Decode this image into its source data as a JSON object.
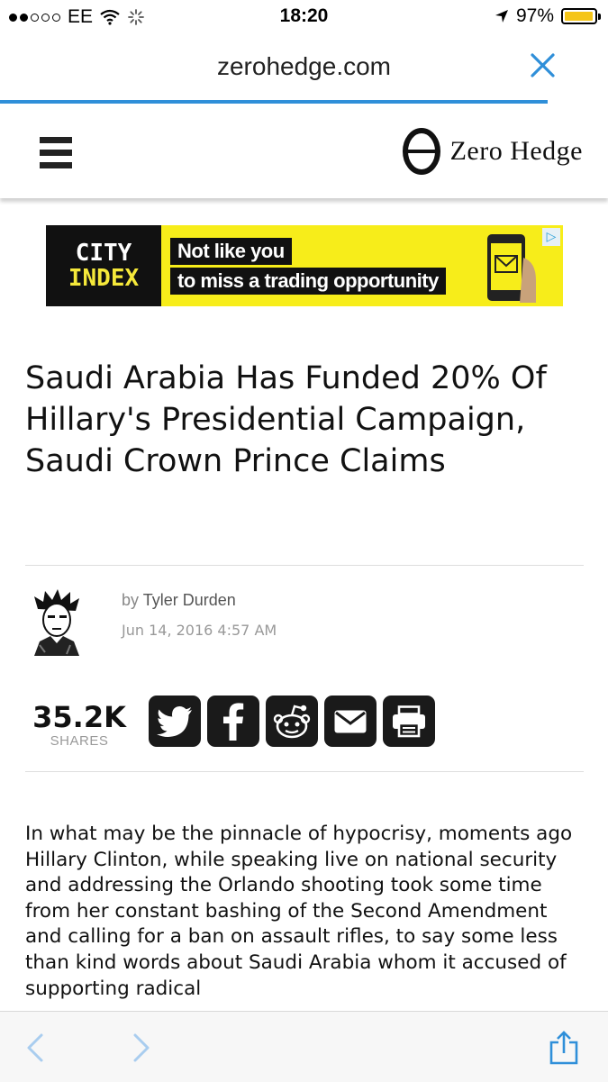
{
  "status_bar": {
    "carrier": "EE",
    "time": "18:20",
    "battery": "97%",
    "battery_level": 0.97
  },
  "browser": {
    "url": "zerohedge.com",
    "load_progress": 0.9
  },
  "site": {
    "logo_text": "Zero Hedge"
  },
  "ad": {
    "brand_line1": "CITY",
    "brand_line2": "INDEX",
    "line1": "Not like you",
    "line2": "to miss a trading opportunity"
  },
  "article": {
    "title": "Saudi Arabia Has Funded 20% Of Hillary's Presidential Campaign, Saudi Crown Prince Claims",
    "by": "by",
    "author": "Tyler Durden",
    "date": "Jun 14, 2016 4:57 AM",
    "share_count": "35.2K",
    "share_label": "SHARES",
    "body_text": "In what may be the pinnacle of hypocrisy, moments ago Hillary Clinton, while speaking live on national security and addressing the Orlando shooting took some time from her constant bashing of the Second Amendment and calling for a ban on assault rifles, to say some less than kind words about Saudi Arabia whom it accused of supporting radical"
  },
  "share_buttons": [
    "twitter-icon",
    "facebook-icon",
    "reddit-icon",
    "email-icon",
    "print-icon"
  ],
  "colors": {
    "accent_blue": "#2f8fd9",
    "ad_yellow": "#f7ed1a",
    "share_button": "#1a1a1a"
  }
}
